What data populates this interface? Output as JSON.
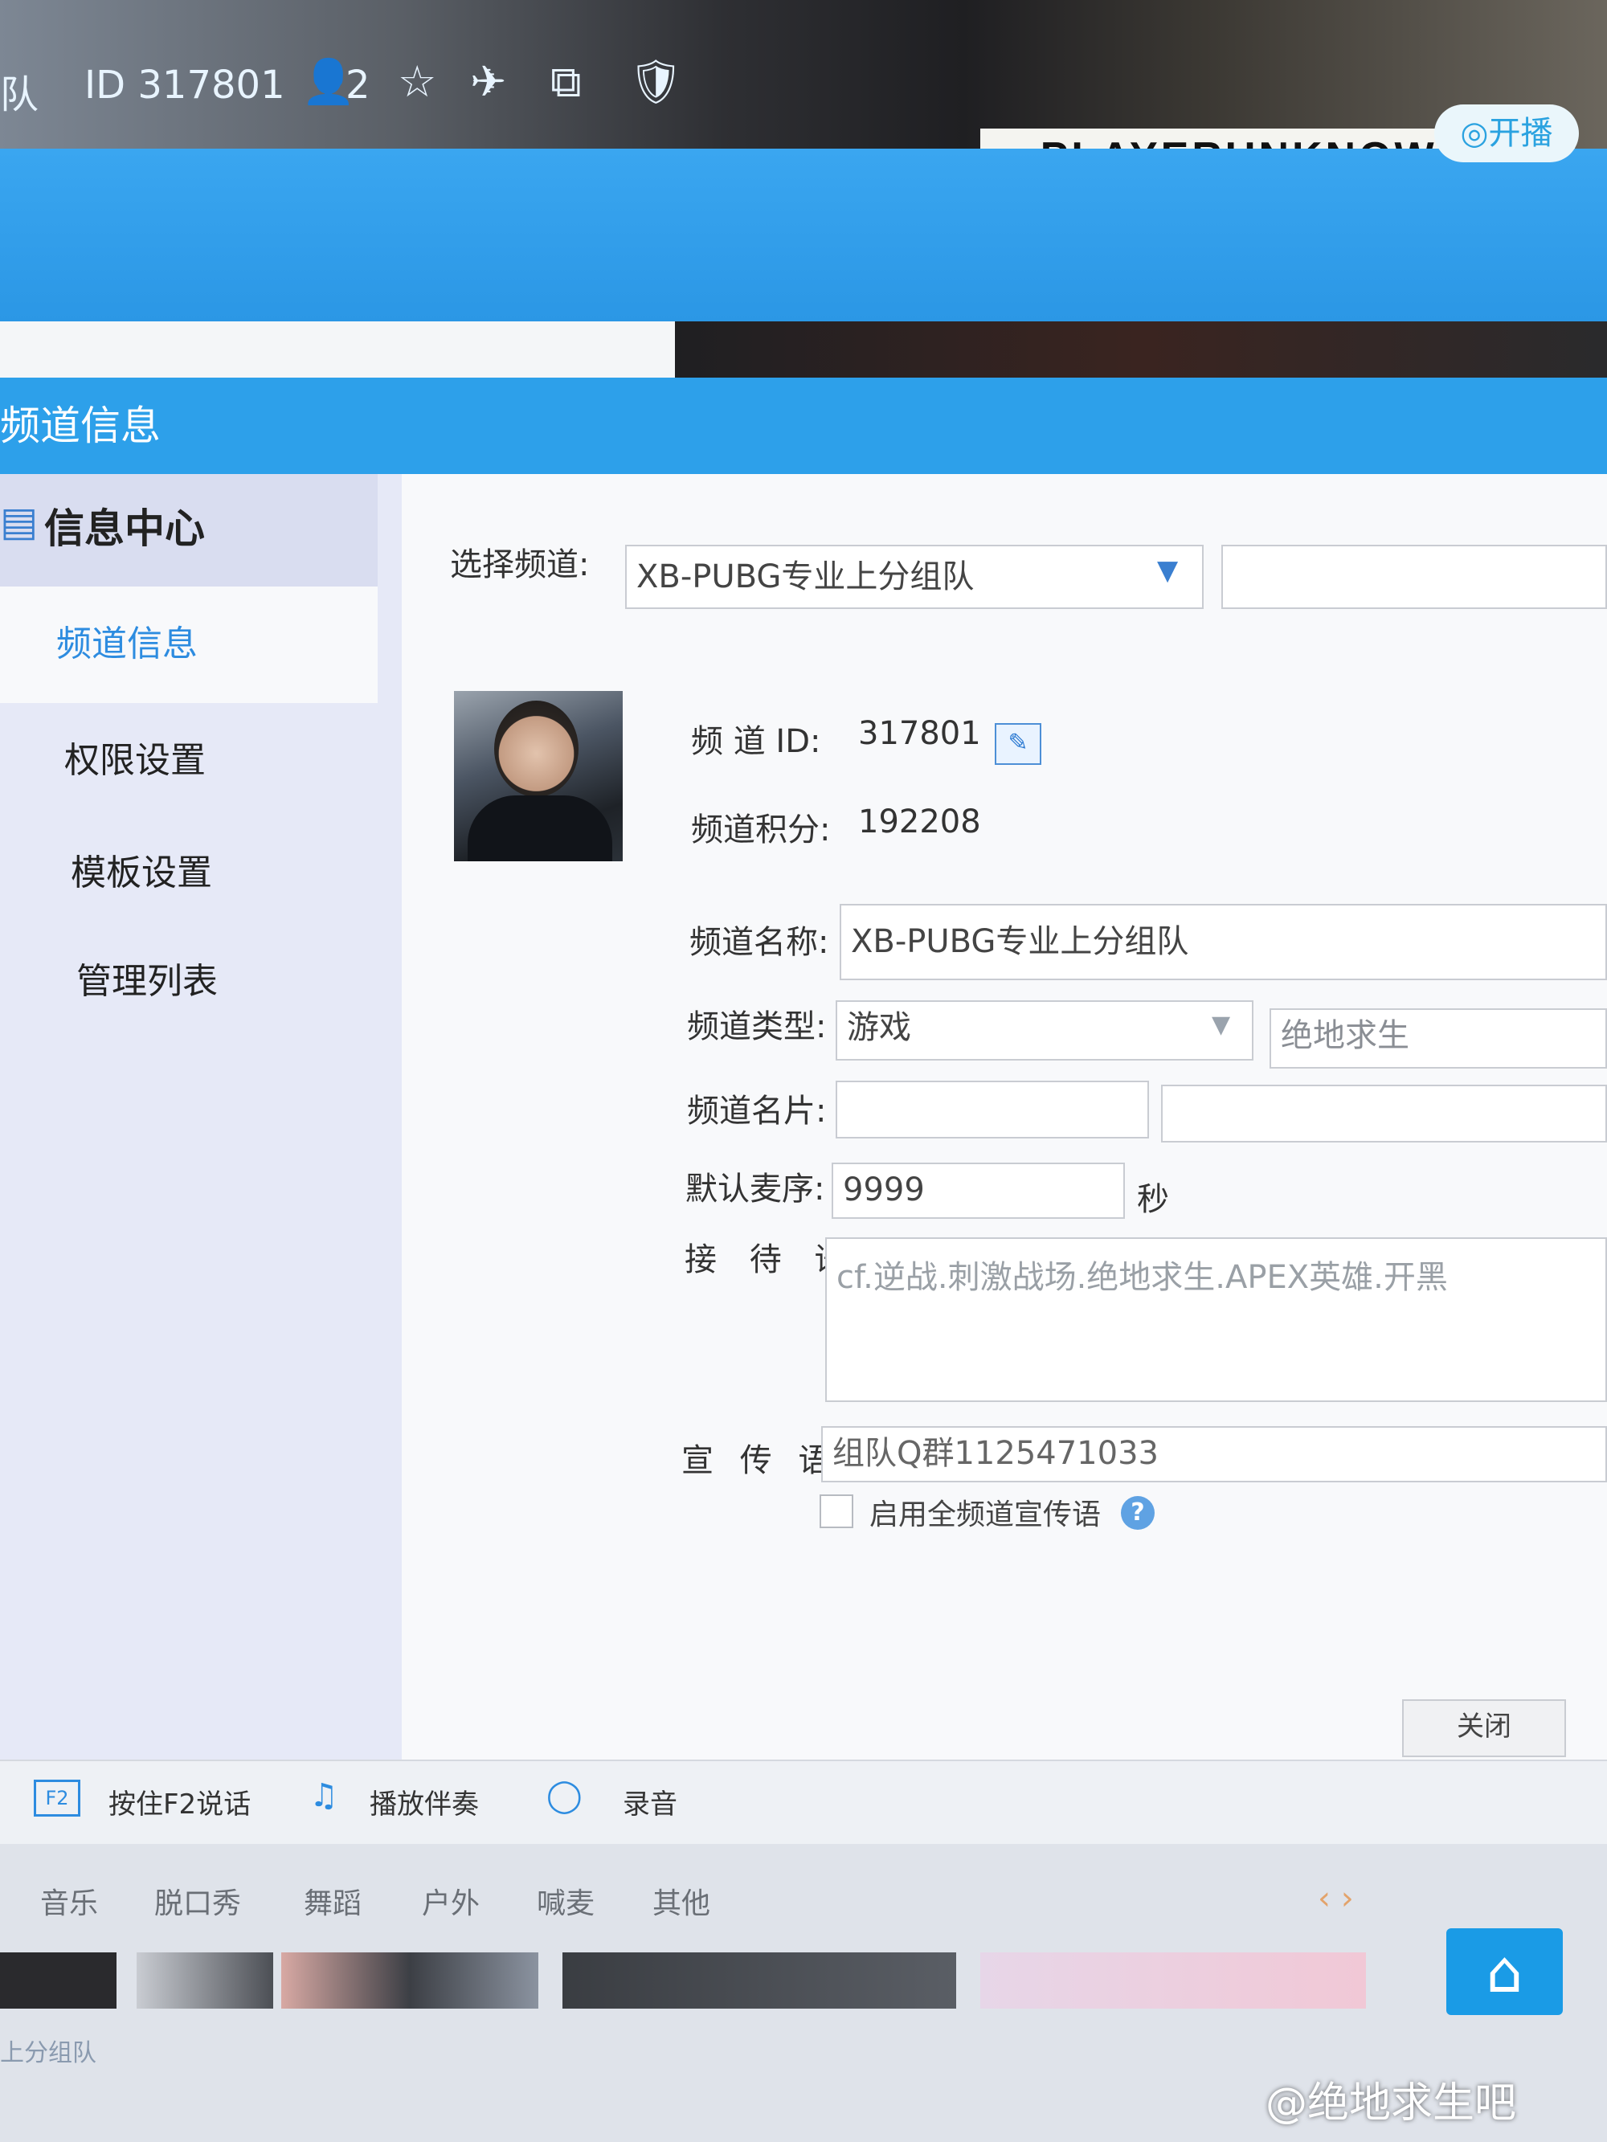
{
  "banner": {
    "title": "PLAYERUNKNOWN'S"
  },
  "header": {
    "team_label": "队",
    "id_label": "ID 317801",
    "online_count": "2",
    "live_button": "开播"
  },
  "dialog": {
    "title": "频道信息"
  },
  "sidebar": {
    "heading": "信息中心",
    "items": [
      {
        "label": "频道信息"
      },
      {
        "label": "权限设置"
      },
      {
        "label": "模板设置"
      },
      {
        "label": "管理列表"
      }
    ]
  },
  "form": {
    "select_channel_label": "选择频道:",
    "select_channel_value": "XB-PUBG专业上分组队",
    "channel_id_label": "频 道 ID:",
    "channel_id_value": "317801",
    "score_label": "频道积分:",
    "score_value": "192208",
    "name_label": "频道名称:",
    "name_value": "XB-PUBG专业上分组队",
    "type_label": "频道类型:",
    "type_value": "游戏",
    "type_sub_value": "绝地求生",
    "card_label": "频道名片:",
    "mic_label": "默认麦序:",
    "mic_value": "9999",
    "mic_unit": "秒",
    "greeting_label": "接 待 语:",
    "greeting_value": "cf.逆战.刺激战场.绝地求生.APEX英雄.开黑",
    "slogan_label": "宣 传 语:",
    "slogan_value": "组队Q群1125471033",
    "slogan_checkbox_label": "启用全频道宣传语",
    "close_button": "关闭"
  },
  "toolbar": {
    "f2_key": "F2",
    "talk_label": "按住F2说话",
    "music_label": "播放伴奏",
    "record_label": "录音"
  },
  "categories": [
    "音乐",
    "脱口秀",
    "舞蹈",
    "户外",
    "喊麦",
    "其他"
  ],
  "bottom": {
    "breadcrumb": "上分组队"
  },
  "watermark": "@绝地求生吧"
}
